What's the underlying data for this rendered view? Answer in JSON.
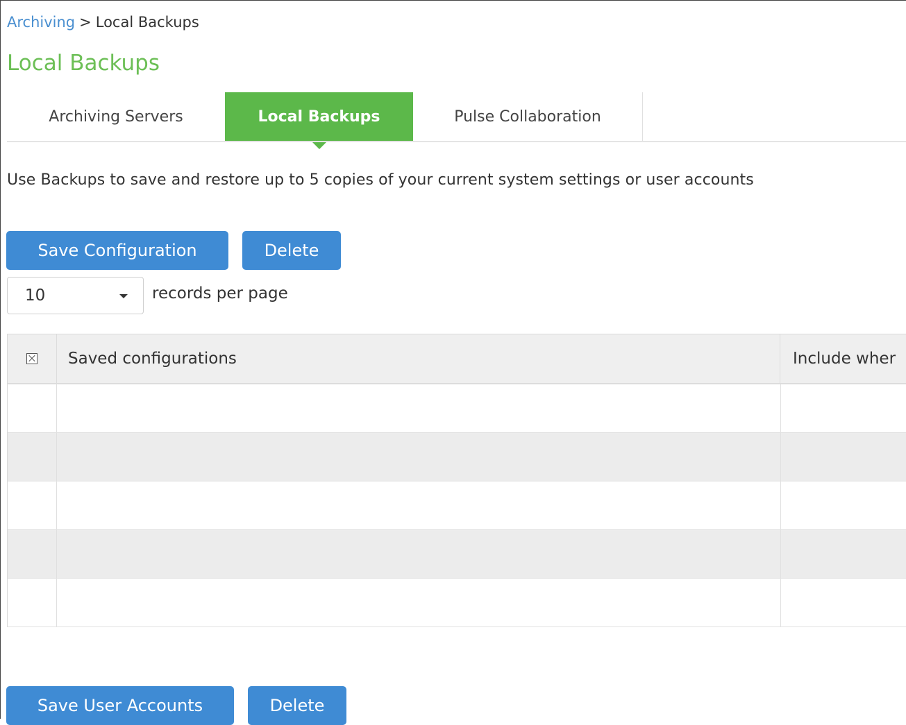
{
  "breadcrumb": {
    "parent": "Archiving",
    "separator": ">",
    "current": "Local Backups"
  },
  "page_title": "Local Backups",
  "tabs": [
    {
      "label": "Archiving Servers",
      "active": false
    },
    {
      "label": "Local Backups",
      "active": true
    },
    {
      "label": "Pulse Collaboration",
      "active": false
    }
  ],
  "description": "Use Backups to save and restore up to 5 copies of your current system settings or user accounts",
  "config_section": {
    "save_label": "Save Configuration",
    "delete_label": "Delete",
    "records_per_page": {
      "value": "10",
      "label": "records per page"
    },
    "table": {
      "columns": [
        "Saved configurations",
        "Include wher"
      ],
      "rows": [
        {
          "name": "",
          "include": ""
        },
        {
          "name": "",
          "include": ""
        },
        {
          "name": "",
          "include": ""
        },
        {
          "name": "",
          "include": ""
        },
        {
          "name": "",
          "include": ""
        }
      ]
    }
  },
  "users_section": {
    "save_label": "Save User Accounts",
    "delete_label": "Delete"
  },
  "colors": {
    "accent_green": "#5cb84a",
    "title_green": "#6cbf56",
    "button_blue": "#3f8bd4",
    "link_blue": "#4a8fd0"
  },
  "icons": {
    "header_checkbox": "checkbox-icon",
    "select_caret": "caret-down-icon"
  }
}
